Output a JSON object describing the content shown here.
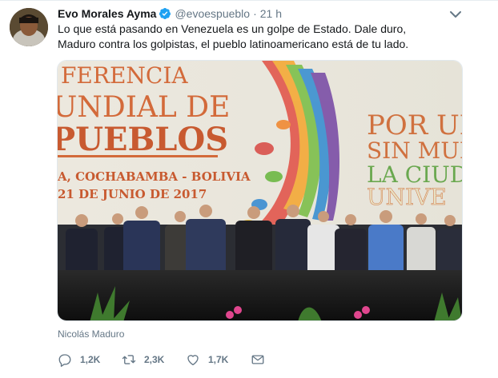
{
  "tweet": {
    "author_name": "Evo Morales Ayma",
    "author_handle": "@evoespueblo",
    "separator": "·",
    "time": "21 h",
    "verified": true,
    "text_lines": [
      "Lo que está pasando en Venezuela es un golpe de Estado. Dale duro,",
      "Maduro contra los golpistas, el pueblo latinoamericano está de tu lado."
    ],
    "media_caption": "Nicolás Maduro",
    "media_banner": {
      "left_lines": [
        "FERENCIA",
        "UNDIAL DE",
        "PUEBLOS",
        "A, COCHABAMBA - BOLIVIA",
        "21 DE JUNIO DE 2017"
      ],
      "right_lines": [
        "POR UN",
        "SIN MUR",
        "LA CIUD",
        "UNIVE"
      ]
    },
    "actions": {
      "reply_count": "1,2K",
      "retweet_count": "2,3K",
      "like_count": "1,7K"
    }
  },
  "colors": {
    "verified_blue": "#1da1f2",
    "muted_text": "#657786",
    "primary_text": "#14171a"
  },
  "icons": {
    "caret": "chevron-down-icon",
    "reply": "reply-icon",
    "retweet": "retweet-icon",
    "like": "heart-icon",
    "dm": "envelope-icon"
  }
}
